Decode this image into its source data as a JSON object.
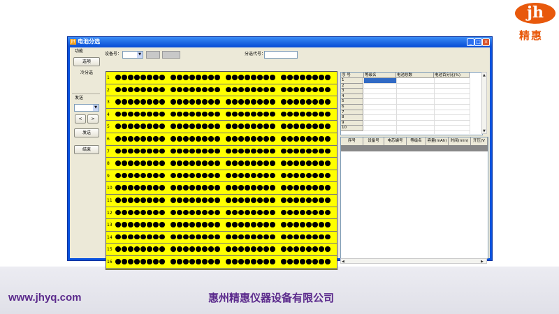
{
  "window": {
    "title": "电池分选",
    "icon_label": "JH"
  },
  "left_panel": {
    "function_label": "功能",
    "select_button": "选项",
    "cold_sort_button": "冷分选",
    "send_label": "发送",
    "prev_button": "<",
    "next_button": ">",
    "send_button": "发送",
    "end_button": "结束"
  },
  "toolbar": {
    "device_label": "设备号：",
    "device_value": "",
    "sort_code_label": "分选代号：",
    "sort_code_value": ""
  },
  "grid": {
    "row_numbers": [
      "1",
      "2",
      "3",
      "4",
      "5",
      "6",
      "7",
      "8",
      "9",
      "10",
      "11",
      "12",
      "13",
      "14",
      "15",
      "16"
    ],
    "groups_per_row": 4,
    "dots_per_group": 8,
    "background_color": "#ffff00",
    "dot_color": "#000000"
  },
  "table1": {
    "headers": [
      "序 号",
      "等级名",
      "电池总数",
      "电池百分比(%)"
    ],
    "rows": [
      "1",
      "2",
      "3",
      "4",
      "5",
      "6",
      "7",
      "8",
      "9",
      "10"
    ]
  },
  "table2": {
    "headers": [
      "序号",
      "设备号",
      "电芯编号",
      "等级名",
      "容量(mAh)",
      "时间(min)",
      "开压(V"
    ]
  },
  "footer": {
    "website": "www.jhyq.com",
    "company": "惠州精惠仪器设备有限公司"
  },
  "logo": {
    "letters": "jh",
    "chinese": "精惠",
    "color": "#e8590c"
  }
}
